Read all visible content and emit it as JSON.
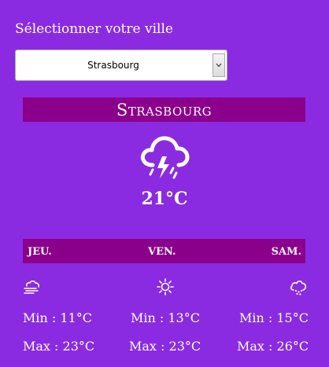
{
  "selector": {
    "label": "Sélectionner votre ville",
    "selected": "Strasbourg"
  },
  "current": {
    "city": "Strasbourg",
    "icon": "thunderstorm-rain-icon",
    "temperature": "21°C"
  },
  "forecast": [
    {
      "day": "JEU.",
      "icon": "cloud-wind-icon",
      "min": "Min : 11°C",
      "max": "Max : 23°C"
    },
    {
      "day": "VEN.",
      "icon": "sun-icon",
      "min": "Min : 13°C",
      "max": "Max : 23°C"
    },
    {
      "day": "SAM.",
      "icon": "cloud-snow-icon",
      "min": "Min : 15°C",
      "max": "Max : 26°C"
    }
  ],
  "colors": {
    "background": "#8a2be2",
    "banner": "#8b008b",
    "text": "#ffffff"
  }
}
